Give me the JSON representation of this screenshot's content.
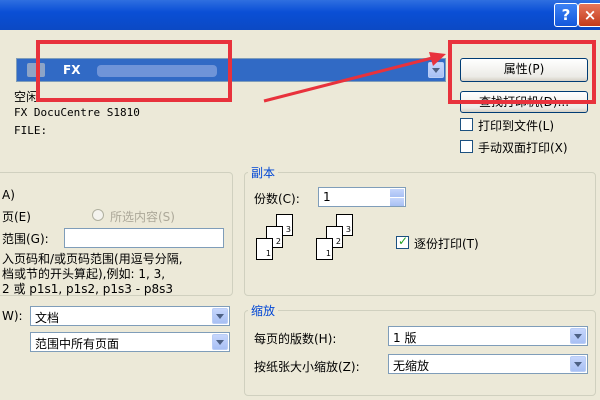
{
  "titlebar": {
    "help_label": "?",
    "close_label": "×"
  },
  "printer": {
    "name_value": "FX",
    "status_label": "空闲",
    "type_value": "FX DocuCentre S1810",
    "where_value": "FILE:",
    "properties_button": "属性(P)",
    "find_printer_button": "查找打印机(D)...",
    "print_to_file": "打印到文件(L)",
    "manual_duplex": "手动双面打印(X)"
  },
  "page_range": {
    "all_label": "A)",
    "current_label": "页(E)",
    "selection_label": "所选内容(S)",
    "pages_label": "范围(G):",
    "hint_lines": [
      "入页码和/或页码范围(用逗号分隔,",
      "档或节的开头算起),例如: 1, 3,",
      "2 或 p1s1, p1s2, p1s3 - p8s3"
    ]
  },
  "copies": {
    "group_title": "副本",
    "count_label": "份数(C):",
    "count_value": "1",
    "collate_label": "逐份打印(T)",
    "collate_checked": true,
    "page_numbers": [
      "3",
      "2",
      "1"
    ]
  },
  "print_what": {
    "label": "W):",
    "value": "文档",
    "print_value": "范围中所有页面"
  },
  "zoom": {
    "group_title": "缩放",
    "pages_per_sheet_label": "每页的版数(H):",
    "pages_per_sheet_value": "1 版",
    "scale_label": "按纸张大小缩放(Z):",
    "scale_value": "无缩放"
  }
}
